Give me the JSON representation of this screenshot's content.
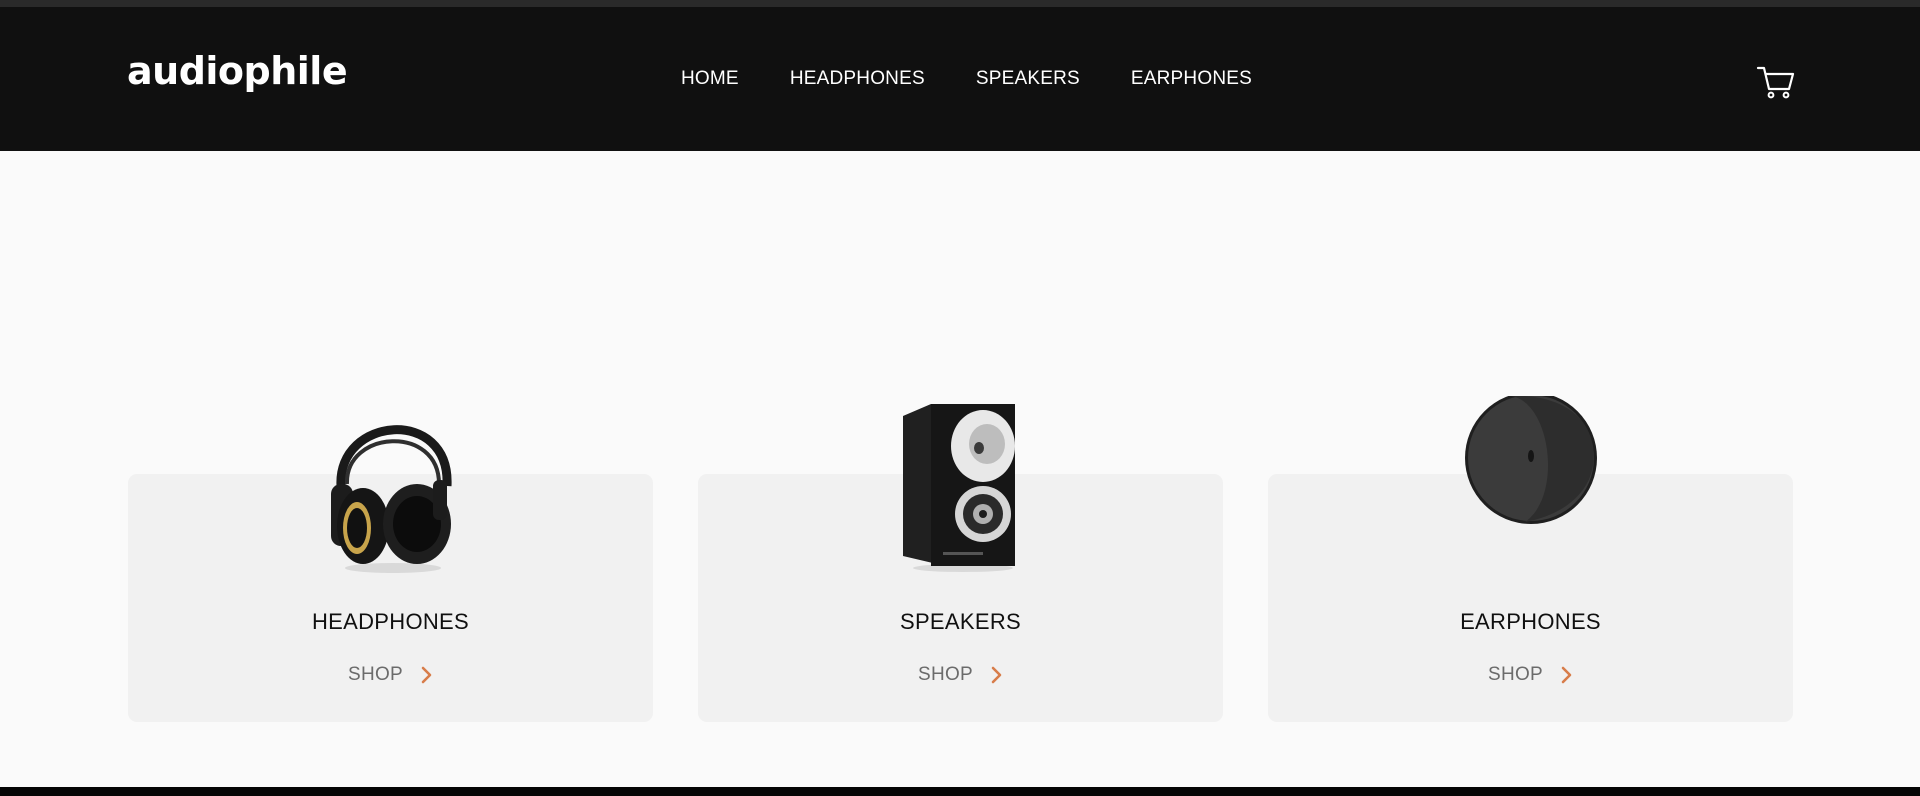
{
  "brand": {
    "logo": "audiophile"
  },
  "nav": {
    "items": [
      {
        "label": "HOME"
      },
      {
        "label": "HEADPHONES"
      },
      {
        "label": "SPEAKERS"
      },
      {
        "label": "EARPHONES"
      }
    ]
  },
  "header": {
    "cart_icon": "cart-icon"
  },
  "categories": [
    {
      "title": "HEADPHONES",
      "shop_label": "SHOP",
      "icon": "headphones-image"
    },
    {
      "title": "SPEAKERS",
      "shop_label": "SHOP",
      "icon": "speaker-image"
    },
    {
      "title": "EARPHONES",
      "shop_label": "SHOP",
      "icon": "earphones-case-image"
    }
  ],
  "colors": {
    "header_bg": "#101010",
    "page_bg": "#fafafa",
    "card_bg": "#f1f1f1",
    "accent": "#d87d4a",
    "shop_text": "#6b6b6b"
  }
}
